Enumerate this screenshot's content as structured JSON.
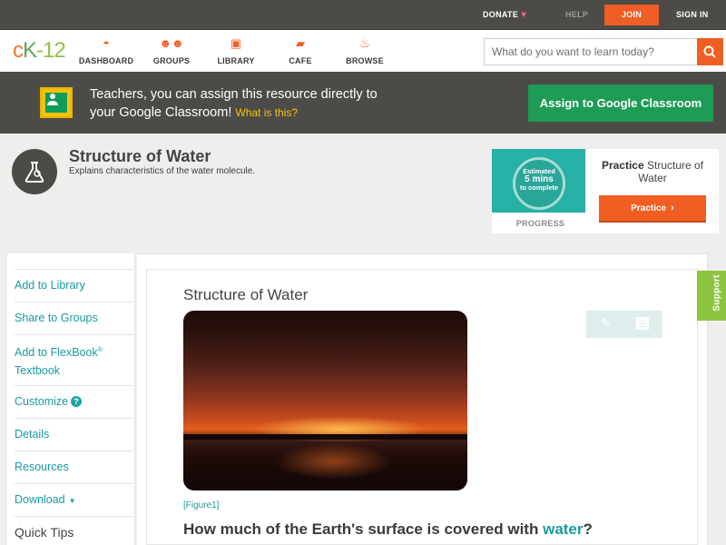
{
  "topbar": {
    "donate": "DONATE",
    "help": "HELP",
    "join": "JOIN",
    "signin": "SIGN IN"
  },
  "header": {
    "logo_part1": "c",
    "logo_part2": "K",
    "logo_part3": "-12",
    "nav": {
      "dashboard": "DASHBOARD",
      "groups": "GROUPS",
      "library": "LIBRARY",
      "cafe": "CAFE",
      "browse": "BROWSE"
    },
    "search_placeholder": "What do you want to learn today?"
  },
  "banner": {
    "text_line1": "Teachers, you can assign this resource directly to",
    "text_line2": "your Google Classroom!",
    "whatis": "What is this?",
    "assign_button": "Assign to Google Classroom"
  },
  "concept": {
    "title": "Structure of Water",
    "subtitle": "Explains characteristics of the water molecule."
  },
  "practice_card": {
    "estimated": "Estimated",
    "mins": "5 mins",
    "to_complete": "to complete",
    "progress_label": "PROGRESS",
    "practice_bold": "Practice",
    "practice_rest": "Structure of Water",
    "practice_button": "Practice"
  },
  "sidebar": {
    "add_to_library": "Add to Library",
    "share_to_groups": "Share to Groups",
    "add_to_flexbook_line1": "Add to FlexBook",
    "registered": "®",
    "add_to_flexbook_line2": "Textbook",
    "customize": "Customize",
    "customize_help": "?",
    "details": "Details",
    "resources": "Resources",
    "download": "Download",
    "download_caret": "▼",
    "quick_tips": "Quick Tips"
  },
  "content": {
    "heading": "Structure of Water",
    "figure_label": "[Figure1]",
    "question_before": "How much of the Earth's surface is covered with ",
    "question_link": "water",
    "question_after": "?"
  },
  "support_tab": "Support",
  "colors": {
    "brand_orange": "#f05e23",
    "classroom_green": "#1e9b55",
    "teal_link": "#1a9a9c",
    "dark_bar": "#4d4b48",
    "support_green": "#8cc43f"
  }
}
